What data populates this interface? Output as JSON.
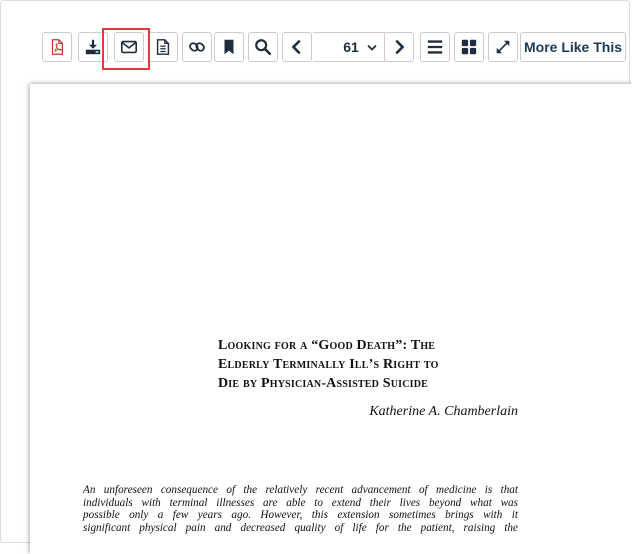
{
  "toolbar": {
    "buttons": [
      {
        "name": "pdf-button",
        "icon": "pdf-icon"
      },
      {
        "name": "download-button",
        "icon": "download-icon"
      },
      {
        "name": "email-button",
        "icon": "envelope-icon"
      },
      {
        "name": "citation-button",
        "icon": "document-icon"
      },
      {
        "name": "link-button",
        "icon": "link-icon"
      },
      {
        "name": "bookmark-button",
        "icon": "bookmark-icon"
      },
      {
        "name": "search-button",
        "icon": "search-icon"
      },
      {
        "name": "previous-page-button",
        "icon": "chevron-left-icon"
      },
      {
        "name": "next-page-button",
        "icon": "chevron-right-icon"
      },
      {
        "name": "list-view-button",
        "icon": "list-icon"
      },
      {
        "name": "grid-view-button",
        "icon": "grid-icon"
      },
      {
        "name": "fullscreen-button",
        "icon": "expand-icon"
      }
    ],
    "page_number": "61",
    "more_like_this": "More Like This"
  },
  "annotation": {
    "highlight_color": "#e8383d",
    "target": "email-button"
  },
  "document": {
    "title_lines": [
      "Looking for a “Good Death”: The",
      "Elderly Terminally Ill’s Right to",
      "Die by Physician-Assisted Suicide"
    ],
    "author": "Katherine A. Chamberlain",
    "abstract_lines": [
      "An unforeseen consequence of the relatively recent advancement of medicine is that",
      "individuals with terminal illnesses are able to extend their lives beyond what was",
      "possible only a few years ago.  However, this extension sometimes brings with it",
      "significant physical pain and decreased quality of life for the patient, raising the"
    ]
  },
  "colors": {
    "icon_navy": "#1f2d3d",
    "pdf_red": "#c0392b",
    "button_border": "#c9ccd1"
  }
}
